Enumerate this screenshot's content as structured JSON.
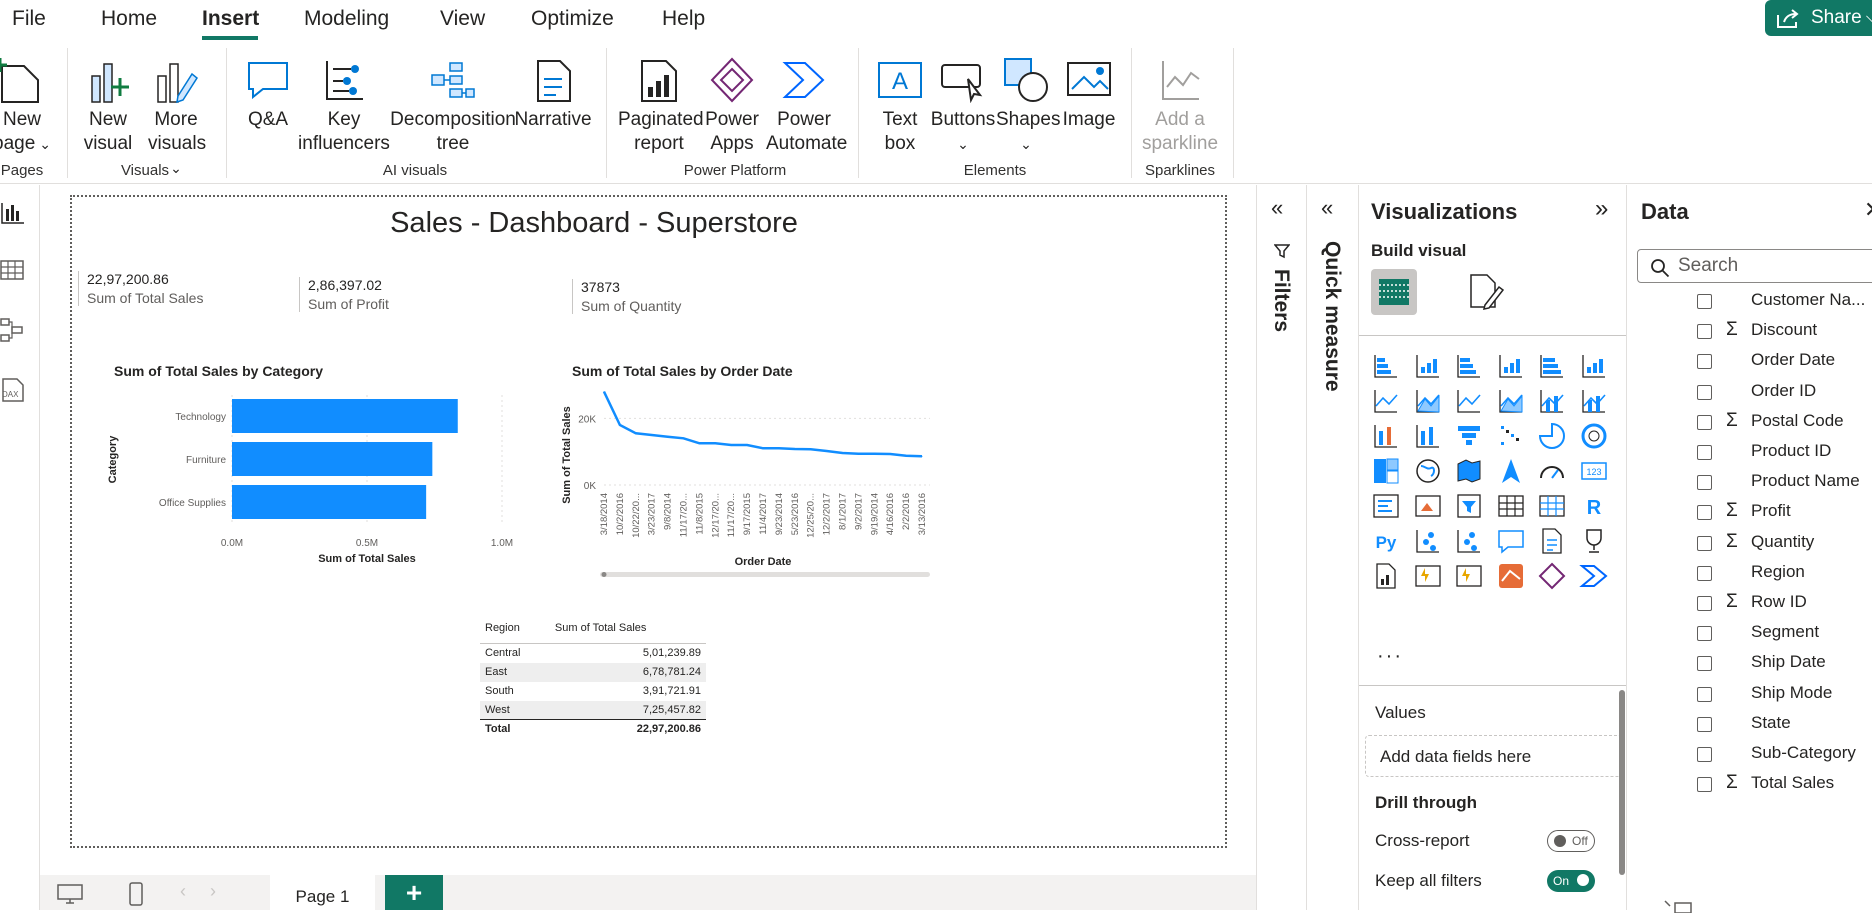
{
  "menu": {
    "items": [
      "File",
      "Home",
      "Insert",
      "Modeling",
      "View",
      "Optimize",
      "Help"
    ],
    "active": "Insert",
    "share_label": "Share"
  },
  "ribbon": {
    "pages": {
      "new_page_line1": "New",
      "new_page_line2": "page",
      "group": "Pages"
    },
    "visuals": {
      "new_visual_1": "New",
      "new_visual_2": "visual",
      "more_visuals_1": "More",
      "more_visuals_2": "visuals",
      "group": "Visuals"
    },
    "ai": {
      "qa": "Q&A",
      "key_1": "Key",
      "key_2": "influencers",
      "decomp_1": "Decomposition",
      "decomp_2": "tree",
      "narrative": "Narrative",
      "group": "AI visuals"
    },
    "platform": {
      "paginated_1": "Paginated",
      "paginated_2": "report",
      "apps_1": "Power",
      "apps_2": "Apps",
      "automate_1": "Power",
      "automate_2": "Automate",
      "group": "Power Platform"
    },
    "elements": {
      "textbox_1": "Text",
      "textbox_2": "box",
      "buttons": "Buttons",
      "shapes": "Shapes",
      "image": "Image",
      "group": "Elements"
    },
    "sparklines": {
      "add_1": "Add a",
      "add_2": "sparkline",
      "group": "Sparklines"
    }
  },
  "report": {
    "title": "Sales - Dashboard - Superstore",
    "kpis": [
      {
        "value": "22,97,200.86",
        "label": "Sum of Total Sales"
      },
      {
        "value": "2,86,397.02",
        "label": "Sum of Profit"
      },
      {
        "value": "37873",
        "label": "Sum of Quantity"
      }
    ],
    "bar_chart_title": "Sum of Total Sales by Category",
    "line_chart_title": "Sum of Total Sales by Order Date",
    "table": {
      "headers": [
        "Region",
        "Sum of Total Sales"
      ],
      "rows": [
        [
          "Central",
          "5,01,239.89"
        ],
        [
          "East",
          "6,78,781.24"
        ],
        [
          "South",
          "3,91,721.91"
        ],
        [
          "West",
          "7,25,457.82"
        ]
      ],
      "total": [
        "Total",
        "22,97,200.86"
      ]
    }
  },
  "chart_data": [
    {
      "type": "bar",
      "orientation": "horizontal",
      "title": "Sum of Total Sales by Category",
      "categories": [
        "Technology",
        "Furniture",
        "Office Supplies"
      ],
      "values": [
        836154,
        741999,
        719047
      ],
      "xlabel": "Sum of Total Sales",
      "ylabel": "Category",
      "xticks": [
        "0.0M",
        "0.5M",
        "1.0M"
      ],
      "xlim": [
        0,
        1000000
      ],
      "color": "#118DFF"
    },
    {
      "type": "line",
      "title": "Sum of Total Sales by Order Date",
      "x": [
        "3/18/2014",
        "10/2/2016",
        "10/22/20...",
        "3/23/2017",
        "9/8/2014",
        "11/17/20...",
        "11/8/2015",
        "12/17/20...",
        "11/17/20...",
        "9/17/2015",
        "11/4/2017",
        "9/23/2014",
        "5/23/2016",
        "12/25/20...",
        "12/2/2017",
        "8/1/2017",
        "9/2/2017",
        "9/19/2014",
        "4/16/2016",
        "2/2/2016",
        "3/13/2016"
      ],
      "values": [
        28000,
        18000,
        15500,
        15000,
        14500,
        14000,
        12500,
        12500,
        12000,
        12000,
        11000,
        11000,
        10800,
        10700,
        10200,
        9600,
        9400,
        9400,
        9300,
        8800,
        8600
      ],
      "xlabel": "Order Date",
      "ylabel": "Sum of Total Sales",
      "yticks": [
        "0K",
        "20K"
      ],
      "ylim": [
        0,
        30000
      ],
      "color": "#118DFF"
    }
  ],
  "pages": {
    "tab": "Page 1",
    "add": "+"
  },
  "panes": {
    "filters_label": "Filters",
    "quick_measure_label": "Quick measure",
    "viz_title": "Visualizations",
    "build_visual": "Build visual",
    "more_dots": "···",
    "values_label": "Values",
    "values_placeholder": "Add data fields here",
    "drill_through": "Drill through",
    "cross_report": "Cross-report",
    "cross_report_state": "Off",
    "keep_filters": "Keep all filters",
    "keep_filters_state": "On",
    "data_title": "Data",
    "search_placeholder": "Search",
    "fields": [
      {
        "name": "Customer Na...",
        "sigma": false
      },
      {
        "name": "Discount",
        "sigma": true
      },
      {
        "name": "Order Date",
        "sigma": false
      },
      {
        "name": "Order ID",
        "sigma": false
      },
      {
        "name": "Postal Code",
        "sigma": true
      },
      {
        "name": "Product ID",
        "sigma": false
      },
      {
        "name": "Product Name",
        "sigma": false
      },
      {
        "name": "Profit",
        "sigma": true
      },
      {
        "name": "Quantity",
        "sigma": true
      },
      {
        "name": "Region",
        "sigma": false
      },
      {
        "name": "Row ID",
        "sigma": true
      },
      {
        "name": "Segment",
        "sigma": false
      },
      {
        "name": "Ship Date",
        "sigma": false
      },
      {
        "name": "Ship Mode",
        "sigma": false
      },
      {
        "name": "State",
        "sigma": false
      },
      {
        "name": "Sub-Category",
        "sigma": false
      },
      {
        "name": "Total Sales",
        "sigma": true
      }
    ]
  }
}
